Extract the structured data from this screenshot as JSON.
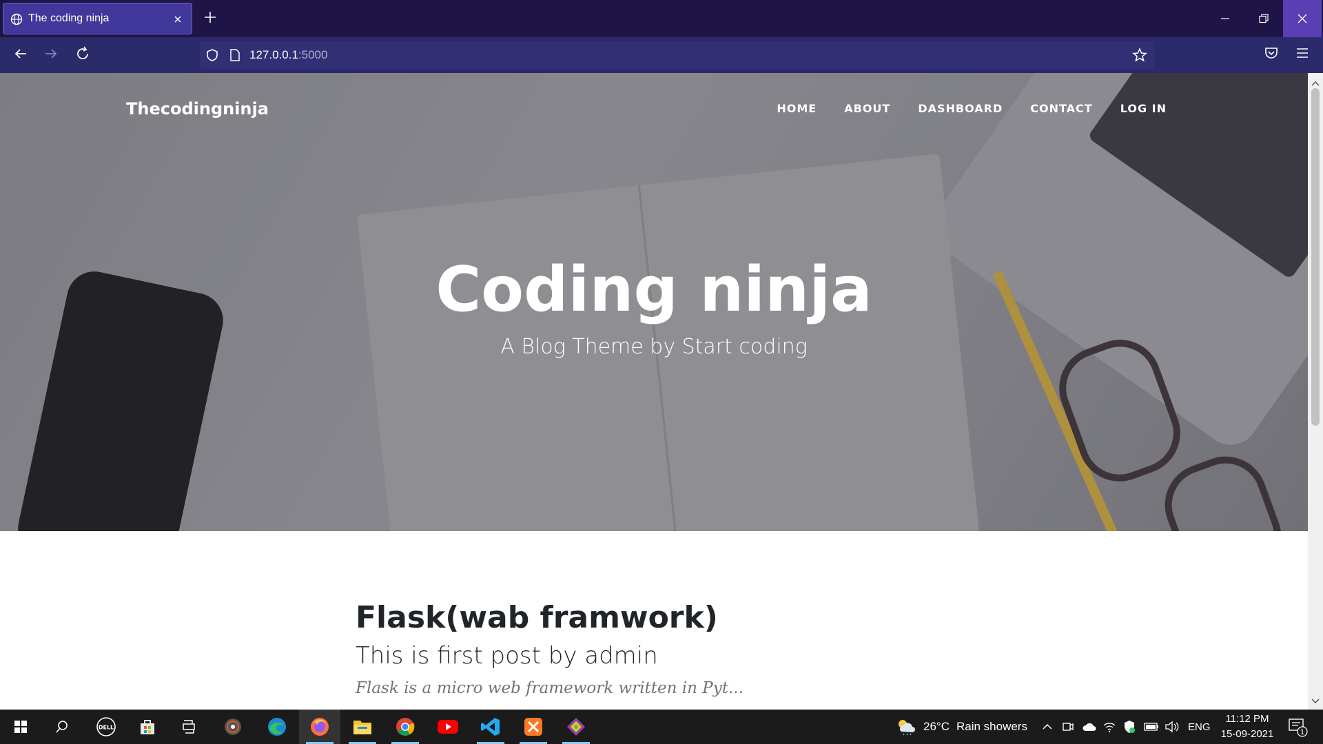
{
  "browser": {
    "tab_title": "The coding ninja",
    "url_host": "127.0.0.1",
    "url_port": ":5000"
  },
  "site": {
    "brand": "Thecodingninja",
    "nav": [
      "HOME",
      "ABOUT",
      "DASHBOARD",
      "CONTACT",
      "LOG IN"
    ],
    "hero_title": "Coding ninja",
    "hero_subtitle": "A Blog Theme by Start coding"
  },
  "post": {
    "title": "Flask(wab framwork)",
    "subtitle": "This is first post by admin",
    "excerpt": "Flask is a micro web framework written in Pyt..."
  },
  "taskbar": {
    "weather_temp": "26°C",
    "weather_text": "Rain showers",
    "language": "ENG",
    "time": "11:12 PM",
    "date": "15-09-2021",
    "notification_count": "1",
    "dell_logo": "DELL"
  },
  "colors": {
    "tabbar": "#1e1446",
    "navbar": "#2b2a6b",
    "tab_active": "#42379a"
  }
}
